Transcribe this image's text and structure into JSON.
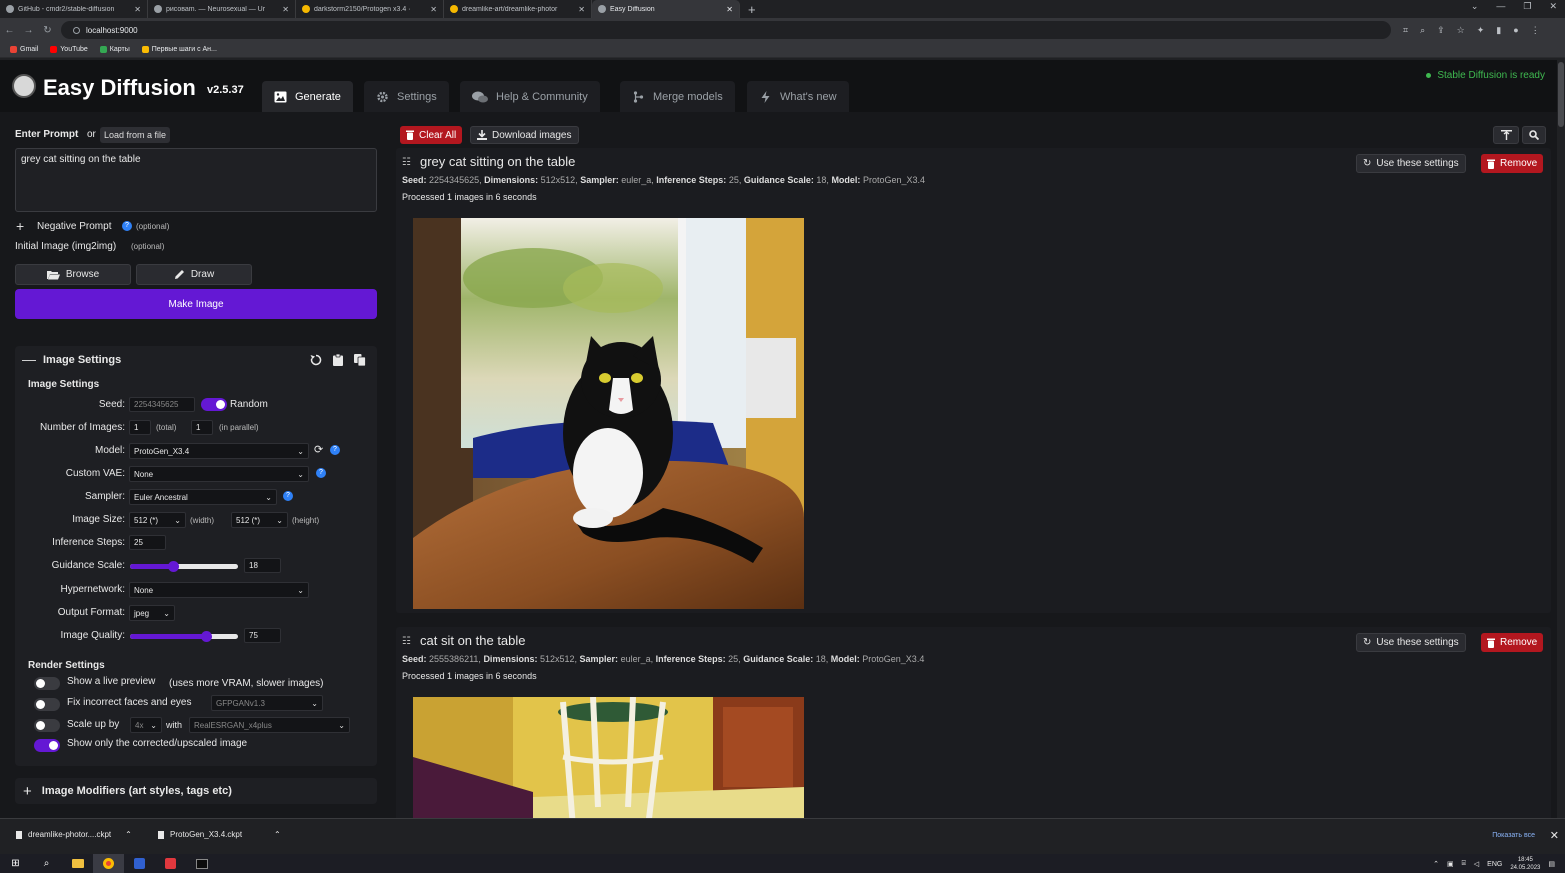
{
  "browser": {
    "tabs": [
      {
        "label": "GitHub - cmdr2/stable-diffusion",
        "active": false
      },
      {
        "label": "рисоваm. — Neurosexual — Ur",
        "active": false
      },
      {
        "label": "darkstorm2150/Protogen x3.4 ·",
        "active": false
      },
      {
        "label": "dreamlike-art/dreamlike-photor",
        "active": false
      },
      {
        "label": "Easy Diffusion",
        "active": true
      }
    ],
    "url": "localhost:9000",
    "bookmarks": [
      "Gmail",
      "YouTube",
      "Карты",
      "Первые шаги с Ан..."
    ]
  },
  "app": {
    "name": "Easy Diffusion",
    "version": "v2.5.37",
    "status": "Stable Diffusion is ready",
    "nav_tabs": [
      "Generate",
      "Settings",
      "Help & Community",
      "Merge models",
      "What's new"
    ]
  },
  "left": {
    "enter_prompt": "Enter Prompt",
    "or": "or",
    "load_file": "Load from a file",
    "prompt_value": "grey cat sitting on the table",
    "negative_prompt": "Negative Prompt",
    "optional": "(optional)",
    "initial_image": "Initial Image (img2img)",
    "browse": "Browse",
    "draw": "Draw",
    "make_image": "Make Image",
    "image_settings_title": "Image Settings",
    "image_settings_sub": "Image Settings",
    "seed_label": "Seed:",
    "seed_value": "2254345625",
    "random_label": "Random",
    "num_images_label": "Number of Images:",
    "num_total": "1",
    "total_hint": "(total)",
    "num_parallel": "1",
    "parallel_hint": "(in parallel)",
    "model_label": "Model:",
    "model_value": "ProtoGen_X3.4",
    "vae_label": "Custom VAE:",
    "vae_value": "None",
    "sampler_label": "Sampler:",
    "sampler_value": "Euler Ancestral",
    "size_label": "Image Size:",
    "width_value": "512 (*)",
    "width_hint": "(width)",
    "height_value": "512 (*)",
    "height_hint": "(height)",
    "steps_label": "Inference Steps:",
    "steps_value": "25",
    "guidance_label": "Guidance Scale:",
    "guidance_value": "18",
    "guidance_fraction": 0.4,
    "hypernetwork_label": "Hypernetwork:",
    "hypernetwork_value": "None",
    "format_label": "Output Format:",
    "format_value": "jpeg",
    "quality_label": "Image Quality:",
    "quality_value": "75",
    "quality_fraction": 0.7,
    "render_settings": "Render Settings",
    "live_preview": "Show a live preview",
    "live_preview_hint": "(uses more VRAM, slower images)",
    "fix_faces": "Fix incorrect faces and eyes",
    "fix_faces_model": "GFPGANv1.3",
    "scale_up": "Scale up by",
    "scale_value": "4x",
    "with_label": "with",
    "upscaler_value": "RealESRGAN_x4plus",
    "show_corrected": "Show only the corrected/upscaled image",
    "modifiers": "Image Modifiers (art styles, tags etc)"
  },
  "right": {
    "clear_all": "Clear All",
    "download_images": "Download images",
    "use_settings": "Use these settings",
    "remove": "Remove",
    "labels": {
      "seed": "Seed:",
      "dims": "Dimensions:",
      "sampler": "Sampler:",
      "steps": "Inference Steps:",
      "guidance": "Guidance Scale:",
      "model": "Model:"
    },
    "results": [
      {
        "title": "grey cat sitting on the table",
        "seed": "2254345625",
        "dims": "512x512",
        "sampler": "euler_a",
        "steps": "25",
        "guidance": "18",
        "model": "ProtoGen_X3.4",
        "processed": "Processed 1 images in 6 seconds"
      },
      {
        "title": "cat sit on the table",
        "seed": "2555386211",
        "dims": "512x512",
        "sampler": "euler_a",
        "steps": "25",
        "guidance": "18",
        "model": "ProtoGen_X3.4",
        "processed": "Processed 1 images in 6 seconds"
      }
    ]
  },
  "downloads": {
    "items": [
      "dreamlike-photor....ckpt",
      "ProtoGen_X3.4.ckpt"
    ],
    "show_all": "Показать все"
  },
  "taskbar": {
    "lang": "ENG",
    "time": "18:45",
    "date": "24.05.2023"
  },
  "colors": {
    "accent": "#6418d4",
    "danger": "#b3171f",
    "ready": "#3fb950",
    "help": "#2f81f7"
  }
}
